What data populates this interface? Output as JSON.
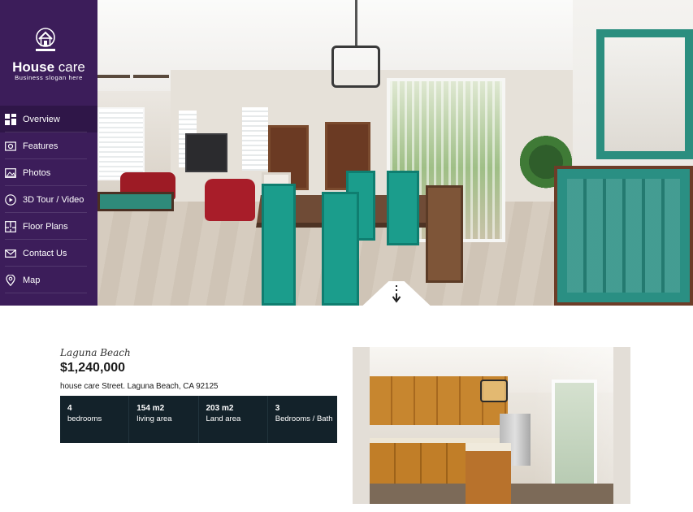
{
  "brand": {
    "name_bold": "House",
    "name_rest": " care",
    "slogan": "Business slogan here",
    "logo_icon": "house-icon"
  },
  "nav": {
    "items": [
      {
        "label": "Overview",
        "icon": "overview-grid-icon",
        "active": true
      },
      {
        "label": "Features",
        "icon": "features-icon",
        "active": false
      },
      {
        "label": "Photos",
        "icon": "photos-icon",
        "active": false
      },
      {
        "label": "3D Tour / Video",
        "icon": "play-circle-icon",
        "active": false
      },
      {
        "label": "Floor Plans",
        "icon": "floor-plan-icon",
        "active": false
      },
      {
        "label": "Contact Us",
        "icon": "envelope-icon",
        "active": false
      },
      {
        "label": "Map",
        "icon": "map-pin-icon",
        "active": false
      }
    ]
  },
  "hero": {
    "scroll_icon": "arrow-down-icon"
  },
  "listing": {
    "location": "Laguna Beach",
    "price": "$1,240,000",
    "address": "house care Street. Laguna Beach, CA 92125",
    "stats": [
      {
        "value": "4",
        "label": "bedrooms"
      },
      {
        "value": "154 m2",
        "label": "living area"
      },
      {
        "value": "203 m2",
        "label": "Land area"
      },
      {
        "value": "3",
        "label": "Bedrooms / Bath"
      }
    ]
  },
  "colors": {
    "sidebar": "#3c1d5a",
    "sidebar_active": "#2f1648",
    "stats_bar": "#13222a",
    "text_dark": "#1a1a1a"
  }
}
